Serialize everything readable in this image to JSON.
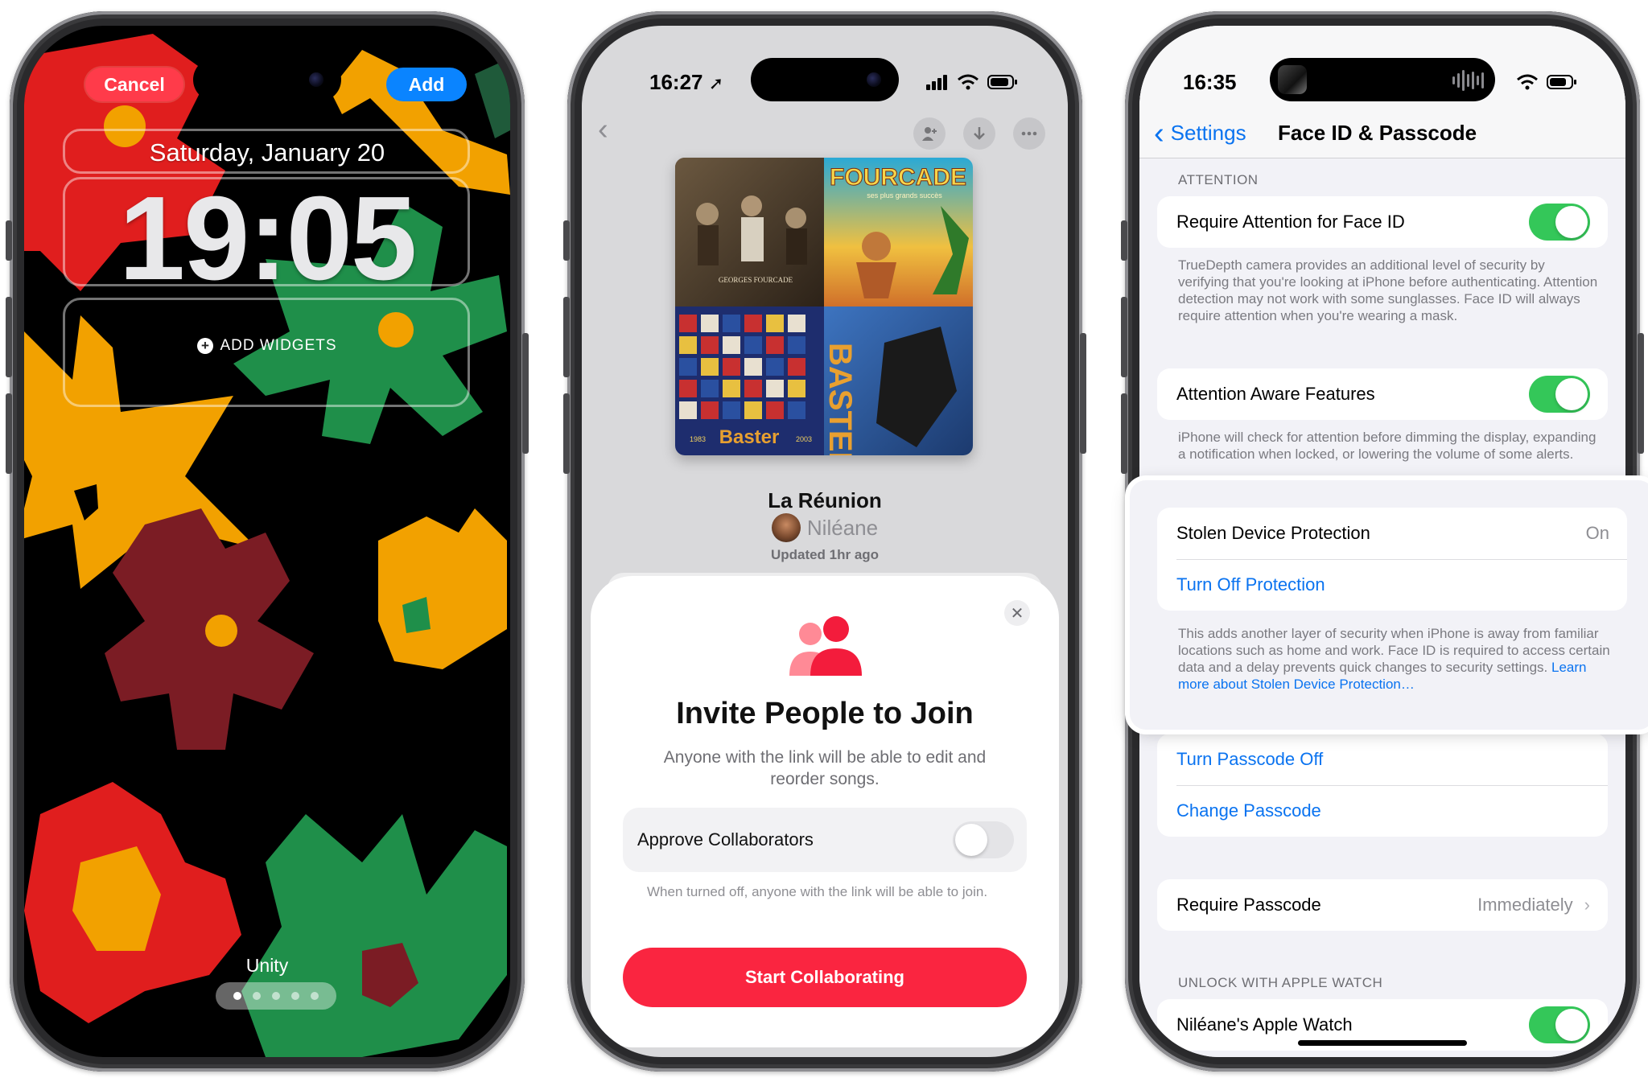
{
  "phone1": {
    "cancel_label": "Cancel",
    "add_label": "Add",
    "date": "Saturday, January 20",
    "time": "19:05",
    "add_widgets_label": "ADD WIDGETS",
    "wallpaper_name": "Unity",
    "pager": {
      "count": 5,
      "active_index": 0
    }
  },
  "phone2": {
    "status_time": "16:27",
    "playlist_title": "La Réunion",
    "owner_name": "Niléane",
    "updated_text": "Updated 1hr ago",
    "artwork_texts": {
      "top_left": "GEORGES FOURCADE",
      "top_right": "FOURCADE",
      "top_right_sub": "ses plus grands succès",
      "bottom_left": "Baster",
      "bottom_left_year_start": "1983",
      "bottom_left_year_end": "2003",
      "bottom_right": "BASTER"
    },
    "sheet": {
      "title": "Invite People to Join",
      "subtitle": "Anyone with the link will be able to edit and reorder songs.",
      "approve_label": "Approve Collaborators",
      "approve_enabled": false,
      "approve_note": "When turned off, anyone with the link will be able to join.",
      "start_button": "Start Collaborating"
    },
    "icons": [
      "chevron-left-icon",
      "add-person-icon",
      "download-icon",
      "more-icon",
      "close-icon",
      "people-icon"
    ]
  },
  "phone3": {
    "status_time": "16:35",
    "back_label": "Settings",
    "title": "Face ID & Passcode",
    "attention_header": "ATTENTION",
    "require_attention_label": "Require Attention for Face ID",
    "require_attention_on": true,
    "require_attention_note": "TrueDepth camera provides an additional level of security by verifying that you're looking at iPhone before authenticating. Attention detection may not work with some sunglasses. Face ID will always require attention when you're wearing a mask.",
    "attention_aware_label": "Attention Aware Features",
    "attention_aware_on": true,
    "attention_aware_note": "iPhone will check for attention before dimming the display, expanding a notification when locked, or lowering the volume of some alerts.",
    "stolen_label": "Stolen Device Protection",
    "stolen_value": "On",
    "turn_off_protection": "Turn Off Protection",
    "stolen_note": "This adds another layer of security when iPhone is away from familiar locations such as home and work. Face ID is required to access certain data and a delay prevents quick changes to security settings.",
    "stolen_link": "Learn more about Stolen Device Protection…",
    "turn_passcode_off": "Turn Passcode Off",
    "change_passcode": "Change Passcode",
    "require_passcode_label": "Require Passcode",
    "require_passcode_value": "Immediately",
    "unlock_header": "UNLOCK WITH APPLE WATCH",
    "watch_label": "Niléane's Apple Watch",
    "watch_on": true
  },
  "colors": {
    "ios_blue": "#0a73f0",
    "ios_green": "#34c759",
    "music_red": "#fa2540",
    "cancel_red": "#ff3b4a",
    "add_blue": "#0a84ff"
  }
}
